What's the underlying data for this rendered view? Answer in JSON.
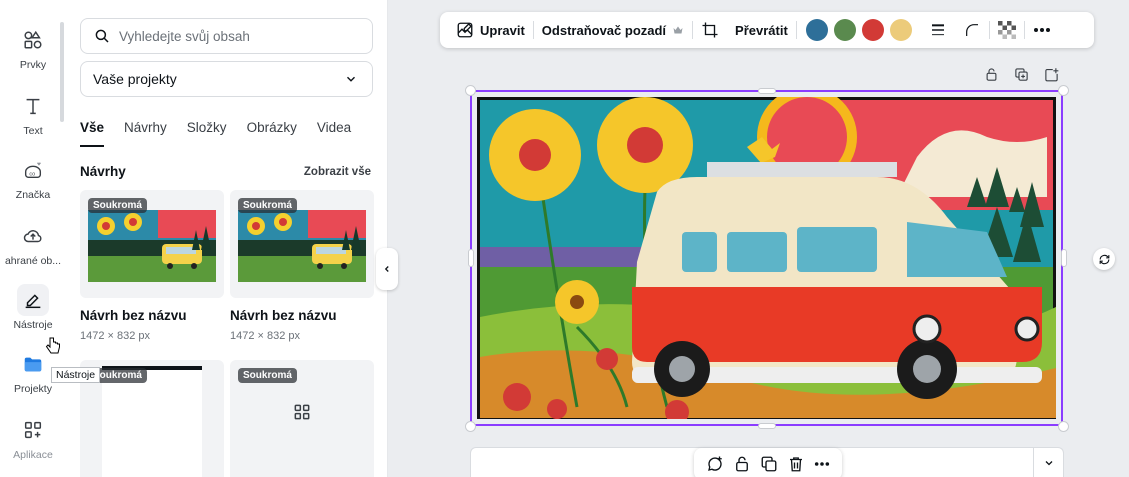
{
  "rail": {
    "items": [
      {
        "label": "Prvky",
        "icon": "elements-icon"
      },
      {
        "label": "Text",
        "icon": "text-icon"
      },
      {
        "label": "Značka",
        "icon": "brand-icon"
      },
      {
        "label": "ahrané ob...",
        "icon": "uploads-icon"
      },
      {
        "label": "Nástroje",
        "icon": "tools-icon"
      },
      {
        "label": "Projekty",
        "icon": "projects-icon"
      },
      {
        "label": "Aplikace",
        "icon": "apps-icon"
      }
    ],
    "tooltip": "Nástroje"
  },
  "panel": {
    "search_placeholder": "Vyhledejte svůj obsah",
    "select_value": "Vaše projekty",
    "tabs": [
      "Vše",
      "Návrhy",
      "Složky",
      "Obrázky",
      "Videa"
    ],
    "section_title": "Návrhy",
    "section_link": "Zobrazit vše",
    "cards": [
      {
        "badge": "Soukromá",
        "title": "Návrh bez názvu",
        "size": "1472 × 832 px"
      },
      {
        "badge": "Soukromá",
        "title": "Návrh bez názvu",
        "size": "1472 × 832 px"
      },
      {
        "badge": "Soukromá"
      },
      {
        "badge": "Soukromá"
      }
    ]
  },
  "toolbar": {
    "edit_label": "Upravit",
    "bg_remover_label": "Odstraňovač pozadí",
    "flip_label": "Převrátit",
    "colors": [
      "#2e6f99",
      "#5a8a4e",
      "#d23a36",
      "#eccb7a"
    ]
  }
}
